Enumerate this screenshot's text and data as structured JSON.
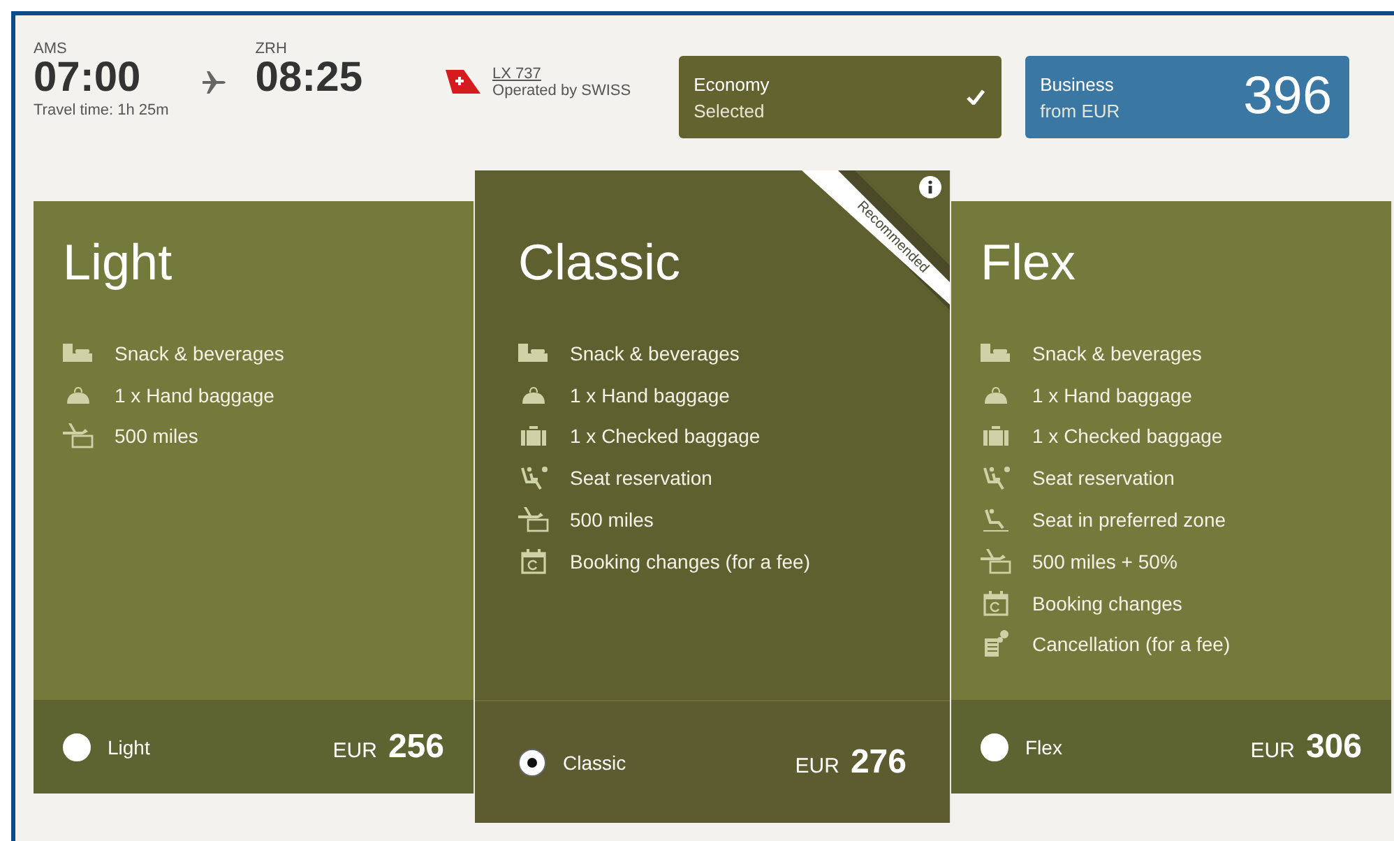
{
  "flight": {
    "from_code": "AMS",
    "departure": "07:00",
    "to_code": "ZRH",
    "arrival": "08:25",
    "travel_time": "Travel time: 1h 25m",
    "flight_number": "LX 737",
    "operator": "Operated by SWISS"
  },
  "cabins": [
    {
      "kind": "selected",
      "name": "Economy",
      "status": "Selected",
      "selected": true
    },
    {
      "kind": "price",
      "name": "Business",
      "status": "from EUR",
      "price": "396",
      "selected": false
    }
  ],
  "fares": [
    {
      "name": "Light",
      "selected": false,
      "recommended": false,
      "option_label": "Light",
      "currency": "EUR",
      "price": "256",
      "features": [
        {
          "kind": "meal",
          "text": "Snack & beverages"
        },
        {
          "kind": "bag",
          "text": "1 x Hand baggage"
        },
        {
          "kind": "miles",
          "text": "500 miles"
        }
      ]
    },
    {
      "name": "Classic",
      "selected": true,
      "recommended": true,
      "ribbon": "Recommended",
      "option_label": "Classic",
      "currency": "EUR",
      "price": "276",
      "features": [
        {
          "kind": "meal",
          "text": "Snack & beverages"
        },
        {
          "kind": "bag",
          "text": "1 x Hand baggage"
        },
        {
          "kind": "suitcase",
          "text": "1 x Checked baggage"
        },
        {
          "kind": "seat",
          "text": "Seat reservation"
        },
        {
          "kind": "miles",
          "text": "500 miles"
        },
        {
          "kind": "calendar",
          "text": "Booking changes (for a fee)"
        }
      ]
    },
    {
      "name": "Flex",
      "selected": false,
      "recommended": false,
      "option_label": "Flex",
      "currency": "EUR",
      "price": "306",
      "features": [
        {
          "kind": "meal",
          "text": "Snack & beverages"
        },
        {
          "kind": "bag",
          "text": "1 x Hand baggage"
        },
        {
          "kind": "suitcase",
          "text": "1 x Checked baggage"
        },
        {
          "kind": "seat",
          "text": "Seat reservation"
        },
        {
          "kind": "seatzone",
          "text": "Seat in preferred zone"
        },
        {
          "kind": "miles",
          "text": "500 miles + 50%"
        },
        {
          "kind": "calendar",
          "text": "Booking changes"
        },
        {
          "kind": "cancel",
          "text": "Cancellation (for a fee)"
        }
      ]
    }
  ]
}
